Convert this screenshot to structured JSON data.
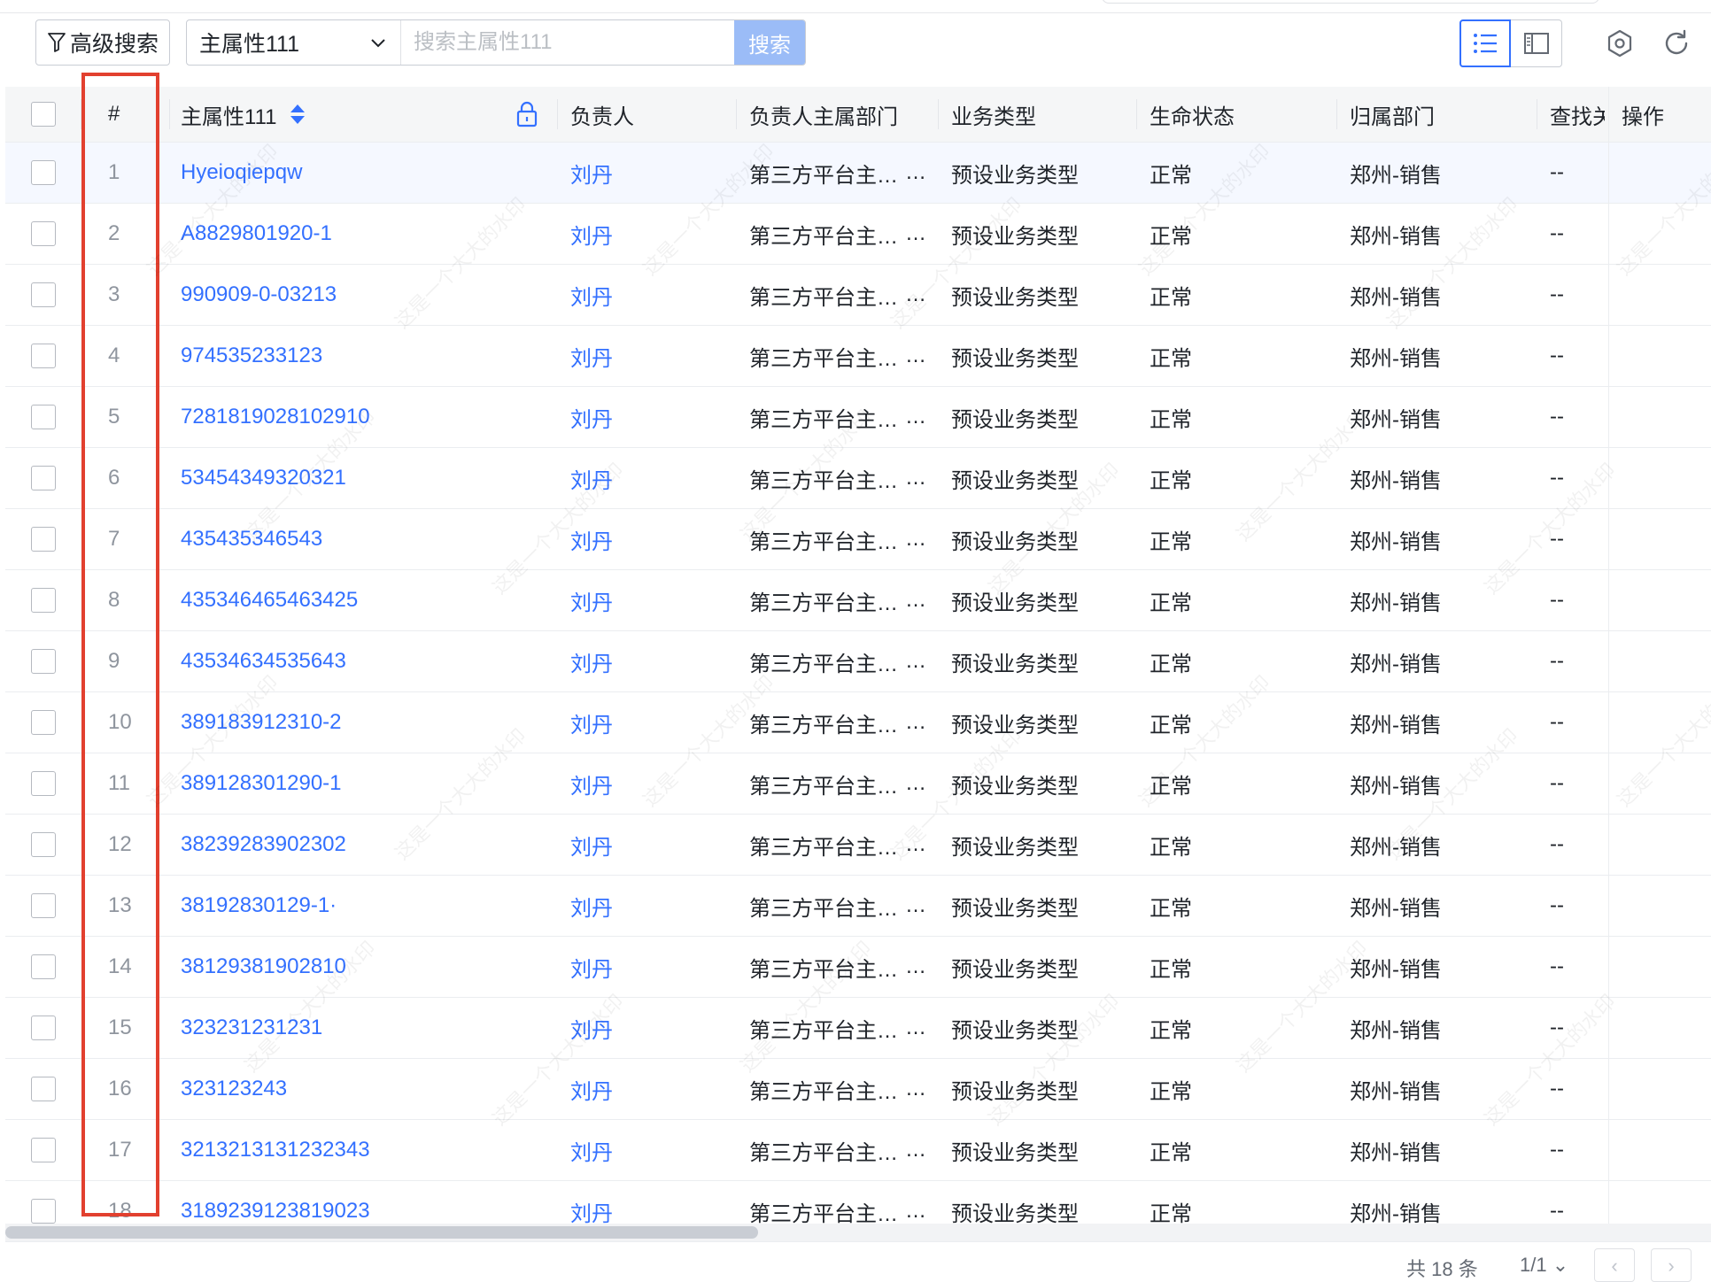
{
  "toolbar": {
    "advanced_search_label": "高级搜索",
    "field_select_value": "主属性111",
    "search_placeholder": "搜索主属性111",
    "search_button_label": "搜索",
    "filter_icon": "filter-icon",
    "list_view_icon": "list-view-icon",
    "panel_view_icon": "panel-view-icon",
    "settings_icon": "settings-icon",
    "refresh_icon": "refresh-icon"
  },
  "table": {
    "headers": {
      "index": "#",
      "main": "主属性111",
      "owner": "负责人",
      "owner_dept": "负责人主属部门",
      "biz_type": "业务类型",
      "life_status": "生命状态",
      "org_dept": "归属部门",
      "find": "查找关",
      "ops": "操作"
    },
    "rows": [
      {
        "no": "1",
        "main": "Hyeioqiepqw",
        "owner": "刘丹",
        "dept": "第三方平台主属部门",
        "type": "预设业务类型",
        "status": "正常",
        "org": "郑州-销售",
        "find": "--"
      },
      {
        "no": "2",
        "main": "A8829801920-1",
        "owner": "刘丹",
        "dept": "第三方平台主属部门",
        "type": "预设业务类型",
        "status": "正常",
        "org": "郑州-销售",
        "find": "--"
      },
      {
        "no": "3",
        "main": "990909-0-03213",
        "owner": "刘丹",
        "dept": "第三方平台主属部门",
        "type": "预设业务类型",
        "status": "正常",
        "org": "郑州-销售",
        "find": "--"
      },
      {
        "no": "4",
        "main": "974535233123",
        "owner": "刘丹",
        "dept": "第三方平台主属部门",
        "type": "预设业务类型",
        "status": "正常",
        "org": "郑州-销售",
        "find": "--"
      },
      {
        "no": "5",
        "main": "7281819028102910",
        "owner": "刘丹",
        "dept": "第三方平台主属部门",
        "type": "预设业务类型",
        "status": "正常",
        "org": "郑州-销售",
        "find": "--"
      },
      {
        "no": "6",
        "main": "53454349320321",
        "owner": "刘丹",
        "dept": "第三方平台主属部门",
        "type": "预设业务类型",
        "status": "正常",
        "org": "郑州-销售",
        "find": "--"
      },
      {
        "no": "7",
        "main": "435435346543",
        "owner": "刘丹",
        "dept": "第三方平台主属部门",
        "type": "预设业务类型",
        "status": "正常",
        "org": "郑州-销售",
        "find": "--"
      },
      {
        "no": "8",
        "main": "435346465463425",
        "owner": "刘丹",
        "dept": "第三方平台主属部门",
        "type": "预设业务类型",
        "status": "正常",
        "org": "郑州-销售",
        "find": "--"
      },
      {
        "no": "9",
        "main": "43534634535643",
        "owner": "刘丹",
        "dept": "第三方平台主属部门",
        "type": "预设业务类型",
        "status": "正常",
        "org": "郑州-销售",
        "find": "--"
      },
      {
        "no": "10",
        "main": "389183912310-2",
        "owner": "刘丹",
        "dept": "第三方平台主属部门",
        "type": "预设业务类型",
        "status": "正常",
        "org": "郑州-销售",
        "find": "--"
      },
      {
        "no": "11",
        "main": "389128301290-1",
        "owner": "刘丹",
        "dept": "第三方平台主属部门",
        "type": "预设业务类型",
        "status": "正常",
        "org": "郑州-销售",
        "find": "--"
      },
      {
        "no": "12",
        "main": "38239283902302",
        "owner": "刘丹",
        "dept": "第三方平台主属部门",
        "type": "预设业务类型",
        "status": "正常",
        "org": "郑州-销售",
        "find": "--"
      },
      {
        "no": "13",
        "main": "38192830129-1·",
        "owner": "刘丹",
        "dept": "第三方平台主属部门",
        "type": "预设业务类型",
        "status": "正常",
        "org": "郑州-销售",
        "find": "--"
      },
      {
        "no": "14",
        "main": "38129381902810",
        "owner": "刘丹",
        "dept": "第三方平台主属部门",
        "type": "预设业务类型",
        "status": "正常",
        "org": "郑州-销售",
        "find": "--"
      },
      {
        "no": "15",
        "main": "323231231231",
        "owner": "刘丹",
        "dept": "第三方平台主属部门",
        "type": "预设业务类型",
        "status": "正常",
        "org": "郑州-销售",
        "find": "--"
      },
      {
        "no": "16",
        "main": "323123243",
        "owner": "刘丹",
        "dept": "第三方平台主属部门",
        "type": "预设业务类型",
        "status": "正常",
        "org": "郑州-销售",
        "find": "--"
      },
      {
        "no": "17",
        "main": "3213213131232343",
        "owner": "刘丹",
        "dept": "第三方平台主属部门",
        "type": "预设业务类型",
        "status": "正常",
        "org": "郑州-销售",
        "find": "--"
      },
      {
        "no": "18",
        "main": "3189239123819023",
        "owner": "刘丹",
        "dept": "第三方平台主属部门",
        "type": "预设业务类型",
        "status": "正常",
        "org": "郑州-销售",
        "find": "--"
      }
    ]
  },
  "watermark": "这是一个大大的水印",
  "footer": {
    "total_label": "共 18 条",
    "page_label": "1/1 ⌄",
    "prev_icon": "chevron-left-icon",
    "next_icon": "chevron-right-icon"
  },
  "colors": {
    "link": "#3370ff",
    "search_button_bg": "#9bbcf7",
    "annotation": "#e2402f",
    "header_bg": "#f5f6f7"
  }
}
